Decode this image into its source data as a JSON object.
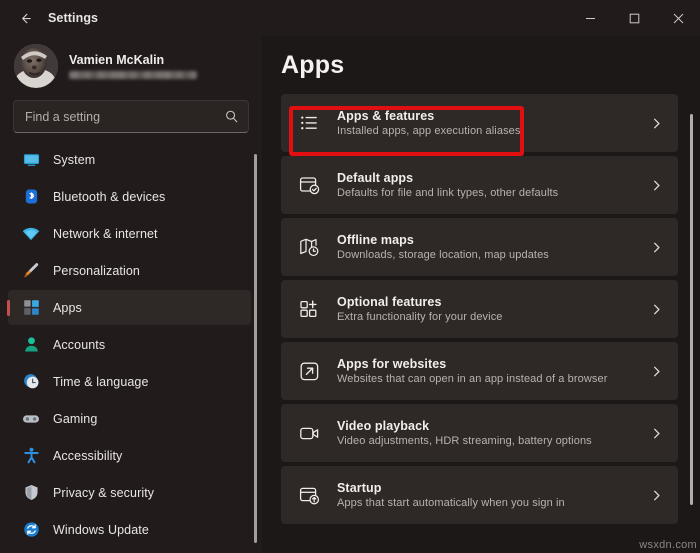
{
  "window": {
    "title": "Settings",
    "back_icon": "back-arrow-icon",
    "minimize_label": "—",
    "maximize_label": "☐",
    "close_label": "✕"
  },
  "account": {
    "name": "Vamien McKalin",
    "email_redacted": true
  },
  "search": {
    "placeholder": "Find a setting",
    "value": "",
    "icon": "search-icon"
  },
  "sidebar": {
    "items": [
      {
        "label": "System",
        "icon": "system-icon",
        "selected": false
      },
      {
        "label": "Bluetooth & devices",
        "icon": "bluetooth-icon",
        "selected": false
      },
      {
        "label": "Network & internet",
        "icon": "wifi-icon",
        "selected": false
      },
      {
        "label": "Personalization",
        "icon": "paintbrush-icon",
        "selected": false
      },
      {
        "label": "Apps",
        "icon": "apps-grid-icon",
        "selected": true
      },
      {
        "label": "Accounts",
        "icon": "person-icon",
        "selected": false
      },
      {
        "label": "Time & language",
        "icon": "clock-icon",
        "selected": false
      },
      {
        "label": "Gaming",
        "icon": "gamepad-icon",
        "selected": false
      },
      {
        "label": "Accessibility",
        "icon": "accessibility-icon",
        "selected": false
      },
      {
        "label": "Privacy & security",
        "icon": "shield-icon",
        "selected": false
      },
      {
        "label": "Windows Update",
        "icon": "update-icon",
        "selected": false
      }
    ]
  },
  "main": {
    "page_title": "Apps",
    "cards": [
      {
        "title": "Apps & features",
        "subtitle": "Installed apps, app execution aliases",
        "icon": "bulleted-list-icon",
        "highlighted": true
      },
      {
        "title": "Default apps",
        "subtitle": "Defaults for file and link types, other defaults",
        "icon": "default-apps-icon",
        "highlighted": false
      },
      {
        "title": "Offline maps",
        "subtitle": "Downloads, storage location, map updates",
        "icon": "map-icon",
        "highlighted": false
      },
      {
        "title": "Optional features",
        "subtitle": "Extra functionality for your device",
        "icon": "add-grid-icon",
        "highlighted": false
      },
      {
        "title": "Apps for websites",
        "subtitle": "Websites that can open in an app instead of a browser",
        "icon": "external-link-icon",
        "highlighted": false
      },
      {
        "title": "Video playback",
        "subtitle": "Video adjustments, HDR streaming, battery options",
        "icon": "video-camera-icon",
        "highlighted": false
      },
      {
        "title": "Startup",
        "subtitle": "Apps that start automatically when you sign in",
        "icon": "startup-icon",
        "highlighted": false
      }
    ],
    "chevron_icon": "chevron-right-icon"
  },
  "annotation": {
    "highlight_color": "#e10f0f"
  },
  "watermark": {
    "text": "wsxdn.com"
  },
  "colors": {
    "window_bg": "#211c1b",
    "main_bg": "#1c1817",
    "card_bg": "#2e2826",
    "accent_selected": "#c0514c",
    "text_primary": "#f2eeec",
    "text_secondary": "#b8b2b0"
  }
}
